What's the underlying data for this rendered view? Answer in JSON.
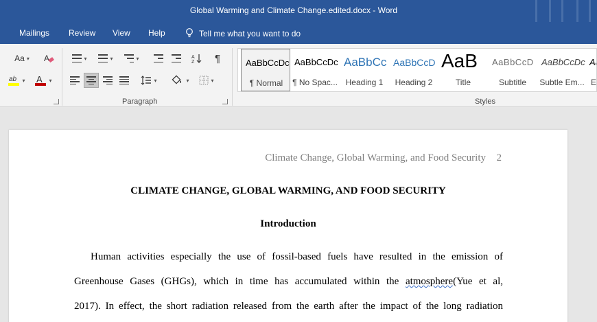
{
  "window": {
    "title": "Global Warming and Climate Change.edited.docx  -  Word"
  },
  "tabs": [
    "Mailings",
    "Review",
    "View",
    "Help"
  ],
  "tell_me": "Tell me what you want to do",
  "ribbon": {
    "groups": {
      "paragraph": "Paragraph",
      "styles": "Styles"
    },
    "font_case_label": "Aa",
    "styles": [
      {
        "preview": "AaBbCcDc",
        "name": "¶ Normal"
      },
      {
        "preview": "AaBbCcDc",
        "name": "¶ No Spac..."
      },
      {
        "preview": "AaBbCc",
        "name": "Heading 1"
      },
      {
        "preview": "AaBbCcD",
        "name": "Heading 2"
      },
      {
        "preview": "AaB",
        "name": "Title"
      },
      {
        "preview": "AaBbCcD",
        "name": "Subtitle"
      },
      {
        "preview": "AaBbCcDc",
        "name": "Subtle Em..."
      },
      {
        "preview": "Aa",
        "name": "E"
      }
    ]
  },
  "document": {
    "header": "Climate Change, Global Warming, and Food Security",
    "page_number": "2",
    "title": "CLIMATE CHANGE, GLOBAL WARMING, AND FOOD SECURITY",
    "heading": "Introduction",
    "para_line1": "Human activities especially the use of fossil-based fuels have resulted in the emission of",
    "para_line2_a": "Greenhouse Gases (GHGs), which in time has accumulated within the ",
    "para_line2_b": "atmosphere",
    "para_line2_c": "(Yue et al,",
    "para_line3": "2017). In effect, the short radiation released from the earth after the impact of the long radiation"
  },
  "colors": {
    "title_bar": "#2b579a",
    "ribbon": "#f3f3f3",
    "font_color_bar": "#c00000",
    "highlight_bar": "#ffff00",
    "heading_blue": "#2e74b5"
  }
}
